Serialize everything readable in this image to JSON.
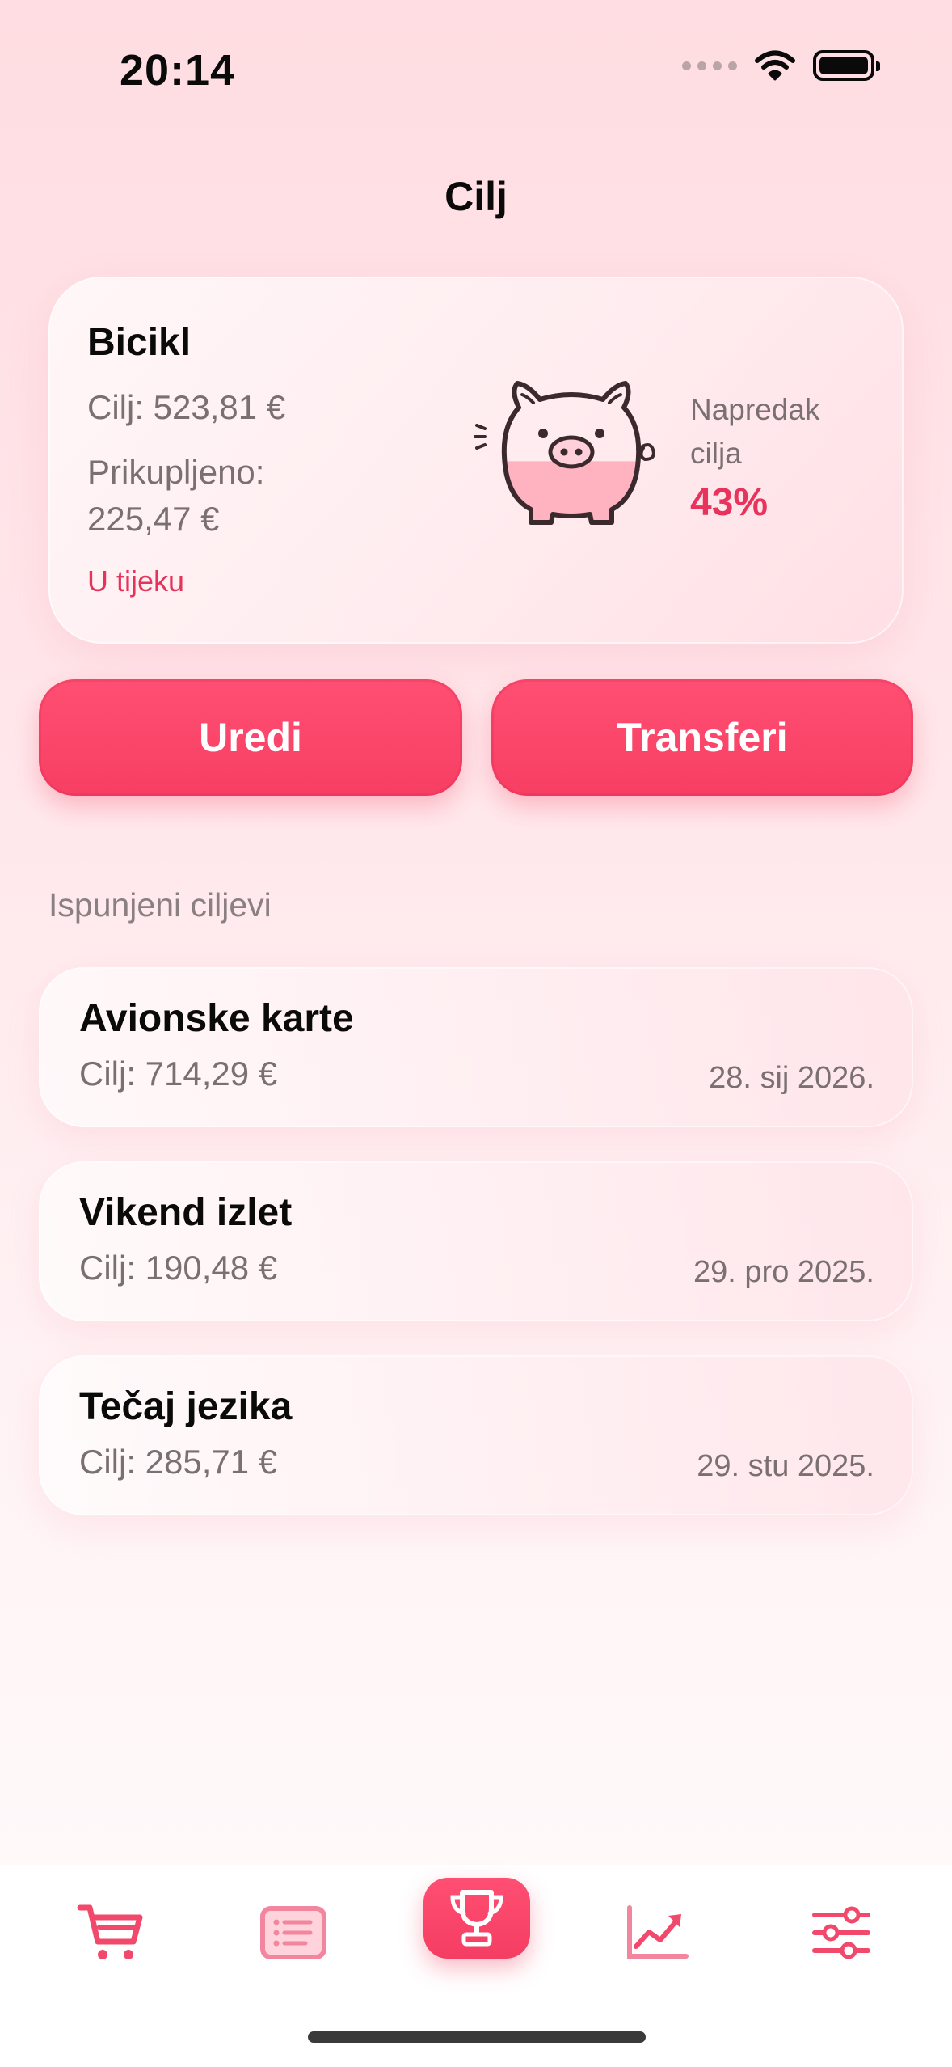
{
  "status_bar": {
    "time": "20:14",
    "icons": [
      "signal-dots-icon",
      "wifi-icon",
      "battery-icon"
    ]
  },
  "header": {
    "title": "Cilj"
  },
  "current_goal": {
    "name": "Bicikl",
    "target": "Cilj: 523,81 €",
    "collected_label": "Prikupljeno:",
    "collected_value": "225,47 €",
    "status": "U tijeku",
    "progress_label": "Napredak cilja",
    "progress_value": "43%",
    "progress_fraction": 0.43,
    "icon": "piggy-bank-icon"
  },
  "actions": {
    "edit_label": "Uredi",
    "transfers_label": "Transferi"
  },
  "completed": {
    "title": "Ispunjeni ciljevi",
    "items": [
      {
        "name": "Avionske karte",
        "target": "Cilj: 714,29 €",
        "date": "28. sij 2026."
      },
      {
        "name": "Vikend izlet",
        "target": "Cilj: 190,48 €",
        "date": "29. pro 2025."
      },
      {
        "name": "Tečaj jezika",
        "target": "Cilj: 285,71 €",
        "date": "29. stu 2025."
      }
    ]
  },
  "tabs": [
    {
      "icon": "cart-icon",
      "active": false
    },
    {
      "icon": "list-icon",
      "active": false
    },
    {
      "icon": "trophy-icon",
      "active": true
    },
    {
      "icon": "chart-icon",
      "active": false
    },
    {
      "icon": "sliders-icon",
      "active": false
    }
  ],
  "colors": {
    "accent": "#f73e63",
    "accent_text": "#e5335a",
    "muted_text": "#7a7072"
  }
}
